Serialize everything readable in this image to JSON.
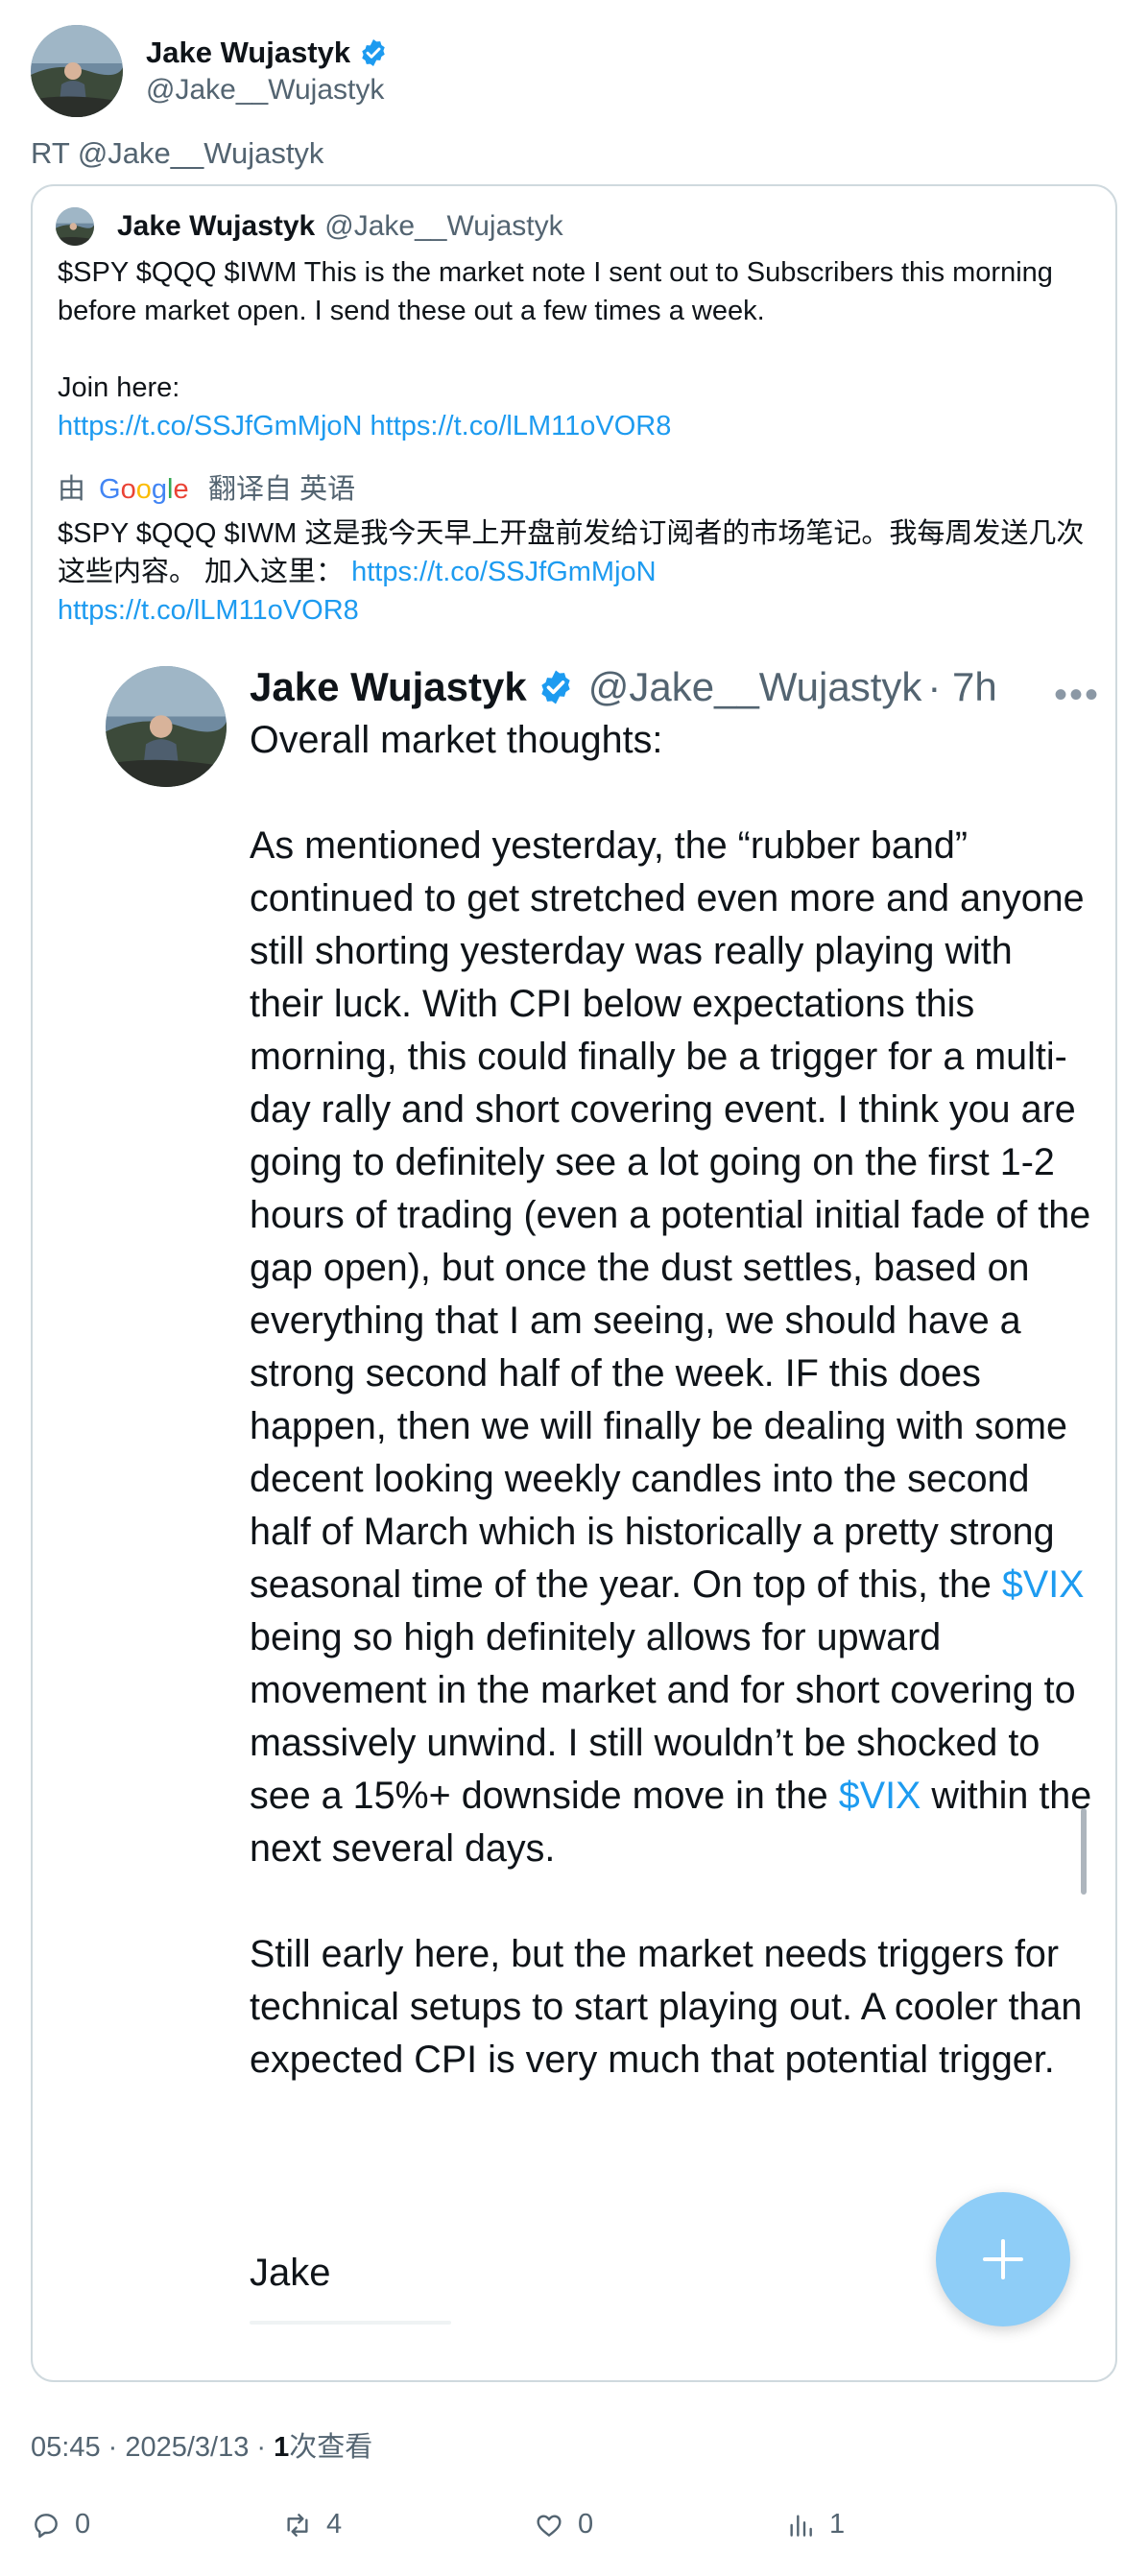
{
  "author": {
    "name": "Jake Wujastyk",
    "handle": "@Jake__Wujastyk"
  },
  "retweet_label": "RT @Jake__Wujastyk",
  "quoted": {
    "name": "Jake Wujastyk",
    "handle": "@Jake__Wujastyk",
    "text_line1": "$SPY $QQQ $IWM This is the market note I sent out to Subscribers this morning before market open. I send these out a few times a week.",
    "join_label": "Join here:",
    "link1": "https://t.co/SSJfGmMjoN",
    "link2": "https://t.co/lLM11oVOR8",
    "translation_prefix": "由",
    "translation_brand": "Google",
    "translation_suffix": "翻译自 英语",
    "translated_text": "$SPY $QQQ $IWM 这是我今天早上开盘前发给订阅者的市场笔记。我每周发送几次这些内容。 加入这里：",
    "translated_link1": "https://t.co/SSJfGmMjoN",
    "translated_link2": "https://t.co/lLM11oVOR8"
  },
  "embedded": {
    "name": "Jake Wujastyk",
    "handle": "@Jake__Wujastyk",
    "time": "· 7h",
    "para1": "Overall market thoughts:",
    "para2_a": "As mentioned yesterday, the “rubber band” continued to get stretched even more and anyone still shorting yesterday was really playing with their luck. With CPI below expectations this morning, this could finally be a trigger for a multi-day rally and short covering event. I think you are going to definitely see a lot going on the first 1-2 hours of trading (even a potential initial fade of the gap open), but once the dust settles, based on everything that I am seeing, we should have a strong second half of the week. IF this does happen, then we will finally be dealing with some decent looking weekly candles into the second half of March which is historically a pretty strong seasonal time of the year. On top of this, the ",
    "cashtag1": "$VIX",
    "para2_b": " being so high definitely allows for upward movement in the market and for short covering to massively unwind. I still wouldn’t be shocked to see a 15%+ downside move in the ",
    "cashtag2": "$VIX",
    "para2_c": " within the next several days.",
    "para3": "Still early here, but the market needs triggers for technical setups to start playing out. A cooler than expected CPI is very much that potential trigger.",
    "signature": "Jake"
  },
  "meta": {
    "time": "05:45 · 2025/3/13 · ",
    "views_count": "1",
    "views_label": "次查看"
  },
  "actions": {
    "replies": "0",
    "retweets": "4",
    "likes": "0",
    "views": "1"
  },
  "colors": {
    "link": "#1d9bf0",
    "fab": "#8ecdf7"
  }
}
